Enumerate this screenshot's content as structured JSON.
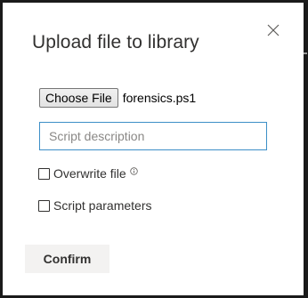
{
  "dialog": {
    "title": "Upload file to library",
    "close_icon": "close-icon",
    "file_picker": {
      "button_label": "Choose File",
      "selected_file": "forensics.ps1"
    },
    "description_input": {
      "value": "",
      "placeholder": "Script description"
    },
    "overwrite_option": {
      "label": "Overwrite file",
      "checked": false,
      "info_icon": "info-icon"
    },
    "parameters_option": {
      "label": "Script parameters",
      "checked": false
    },
    "confirm_label": "Confirm"
  },
  "colors": {
    "title_text": "#323130",
    "input_border_focus": "#3d8fc7",
    "confirm_background": "#f3f2f1",
    "backdrop": "#1a1a1a"
  }
}
